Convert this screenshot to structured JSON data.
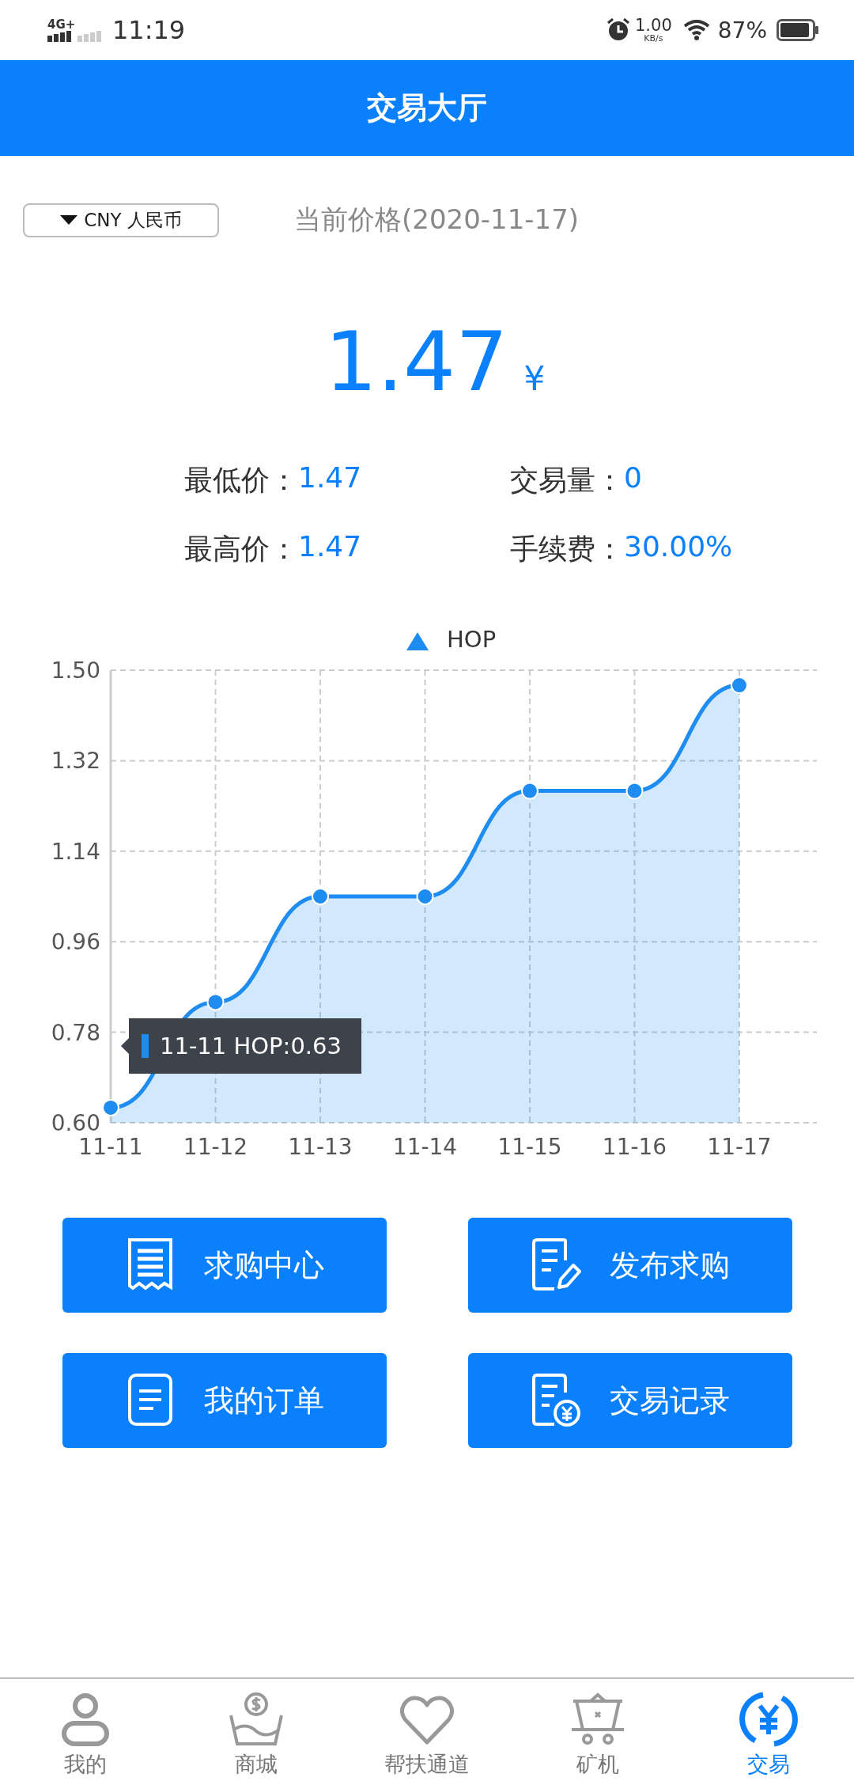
{
  "status_bar": {
    "network": "4G+",
    "time": "11:19",
    "speed": "1.00",
    "speed_unit": "KB/s",
    "battery": "87%"
  },
  "header": {
    "title": "交易大厅"
  },
  "currency_dropdown": {
    "label": "CNY 人民币"
  },
  "price_date": "当前价格(2020-11-17)",
  "price": {
    "value": "1.47",
    "unit": "¥"
  },
  "stats": [
    {
      "label": "最低价：",
      "value": "1.47"
    },
    {
      "label": "交易量：",
      "value": "0"
    },
    {
      "label": "最高价：",
      "value": "1.47"
    },
    {
      "label": "手续费：",
      "value": "30.00%"
    }
  ],
  "chart": {
    "chart_data": {
      "type": "area",
      "categories": [
        "11-11",
        "11-12",
        "11-13",
        "11-14",
        "11-15",
        "11-16",
        "11-17"
      ],
      "series": [
        {
          "name": "HOP",
          "color": "#1e8cf0",
          "values": [
            0.63,
            0.84,
            1.05,
            1.05,
            1.26,
            1.26,
            1.47
          ]
        }
      ],
      "ylim": [
        0.6,
        1.5
      ],
      "grid": true,
      "yticks": [
        {
          "value": 0.6,
          "label": "0.60"
        },
        {
          "value": 0.78,
          "label": "0.78"
        },
        {
          "value": 0.96,
          "label": "0.96"
        },
        {
          "value": 1.14,
          "label": "1.14"
        },
        {
          "value": 1.32,
          "label": "1.32"
        },
        {
          "value": 1.5,
          "label": "1.50"
        }
      ]
    },
    "tooltip": {
      "text": "11-11 HOP:0.63"
    }
  },
  "actions": [
    {
      "label": "求购中心",
      "kind": "receipt"
    },
    {
      "label": "发布求购",
      "kind": "edit"
    },
    {
      "label": "我的订单",
      "kind": "document"
    },
    {
      "label": "交易记录",
      "kind": "record"
    }
  ],
  "tabs": [
    {
      "label": "我的",
      "kind": "person",
      "selected": false
    },
    {
      "label": "商城",
      "kind": "shop",
      "selected": false
    },
    {
      "label": "帮扶通道",
      "kind": "heart",
      "selected": false
    },
    {
      "label": "矿机",
      "kind": "cart",
      "selected": false
    },
    {
      "label": "交易",
      "kind": "exchange",
      "selected": true
    }
  ]
}
